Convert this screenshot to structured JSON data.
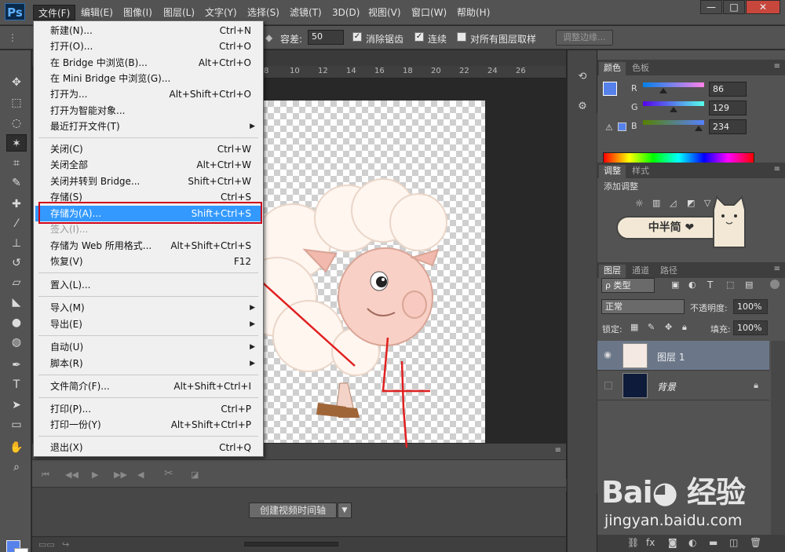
{
  "app": {
    "logo": "Ps"
  },
  "menubar": {
    "items": [
      "文件(F)",
      "编辑(E)",
      "图像(I)",
      "图层(L)",
      "文字(Y)",
      "选择(S)",
      "滤镜(T)",
      "3D(D)",
      "视图(V)",
      "窗口(W)",
      "帮助(H)"
    ],
    "active_index": 0
  },
  "window_controls": {
    "minimize": "—",
    "restore": "□",
    "close": "✕"
  },
  "options": {
    "tolerance_label": "容差:",
    "tolerance_value": "50",
    "antialias_label": "消除锯齿",
    "contiguous_label": "连续",
    "all_layers_label": "对所有图层取样",
    "refine_edge_label": "调整边缘..."
  },
  "ruler": {
    "ticks": [
      "8",
      "10",
      "12",
      "14",
      "16",
      "18",
      "20",
      "22",
      "24",
      "26"
    ]
  },
  "file_menu": {
    "items": [
      {
        "label": "新建(N)...",
        "shortcut": "Ctrl+N"
      },
      {
        "label": "打开(O)...",
        "shortcut": "Ctrl+O"
      },
      {
        "label": "在 Bridge 中浏览(B)...",
        "shortcut": "Alt+Ctrl+O"
      },
      {
        "label": "在 Mini Bridge 中浏览(G)...",
        "shortcut": ""
      },
      {
        "label": "打开为...",
        "shortcut": "Alt+Shift+Ctrl+O"
      },
      {
        "label": "打开为智能对象...",
        "shortcut": ""
      },
      {
        "label": "最近打开文件(T)",
        "shortcut": "",
        "submenu": true
      },
      {
        "label": "关闭(C)",
        "shortcut": "Ctrl+W"
      },
      {
        "label": "关闭全部",
        "shortcut": "Alt+Ctrl+W"
      },
      {
        "label": "关闭并转到 Bridge...",
        "shortcut": "Shift+Ctrl+W"
      },
      {
        "label": "存储(S)",
        "shortcut": "Ctrl+S"
      },
      {
        "label": "存储为(A)...",
        "shortcut": "Shift+Ctrl+S",
        "highlighted": true
      },
      {
        "label": "签入(I)...",
        "shortcut": "",
        "disabled": true
      },
      {
        "label": "存储为 Web 所用格式...",
        "shortcut": "Alt+Shift+Ctrl+S"
      },
      {
        "label": "恢复(V)",
        "shortcut": "F12"
      },
      {
        "label": "置入(L)...",
        "shortcut": ""
      },
      {
        "label": "导入(M)",
        "shortcut": "",
        "submenu": true
      },
      {
        "label": "导出(E)",
        "shortcut": "",
        "submenu": true
      },
      {
        "label": "自动(U)",
        "shortcut": "",
        "submenu": true
      },
      {
        "label": "脚本(R)",
        "shortcut": "",
        "submenu": true
      },
      {
        "label": "文件简介(F)...",
        "shortcut": "Alt+Shift+Ctrl+I"
      },
      {
        "label": "打印(P)...",
        "shortcut": "Ctrl+P"
      },
      {
        "label": "打印一份(Y)",
        "shortcut": "Alt+Shift+Ctrl+P"
      },
      {
        "label": "退出(X)",
        "shortcut": "Ctrl+Q"
      }
    ],
    "submenu_arrow": "▶"
  },
  "annotation": {
    "handwritten": "4"
  },
  "timeline": {
    "create_video_label": "创建视频时间轴",
    "dropdown_arrow": "▼"
  },
  "color_panel": {
    "tabs": [
      "颜色",
      "色板"
    ],
    "channels": [
      {
        "label": "R",
        "value": "86"
      },
      {
        "label": "G",
        "value": "129"
      },
      {
        "label": "B",
        "value": "234"
      }
    ],
    "foreground_hex": "#5681ea"
  },
  "adjust_panel": {
    "tabs": [
      "调整",
      "样式"
    ],
    "add_label": "添加调整",
    "sticker_text": "中半简 ❤"
  },
  "layers_panel": {
    "tabs": [
      "图层",
      "通道",
      "路径"
    ],
    "filter_kind": "ρ 类型",
    "blend_mode": "正常",
    "opacity_label": "不透明度:",
    "opacity_value": "100%",
    "lock_label": "锁定:",
    "fill_label": "填充:",
    "fill_value": "100%",
    "layers": [
      {
        "name": "图层 1",
        "visible": true,
        "selected": true
      },
      {
        "name": "背景",
        "visible": false,
        "locked": true
      }
    ]
  },
  "watermark": {
    "logo": "Bai◕ 经验",
    "url": "jingyan.baidu.com"
  },
  "colors": {
    "accent": "#3399ff",
    "highlight_box": "#d0021b",
    "annotation": "#e02020"
  }
}
